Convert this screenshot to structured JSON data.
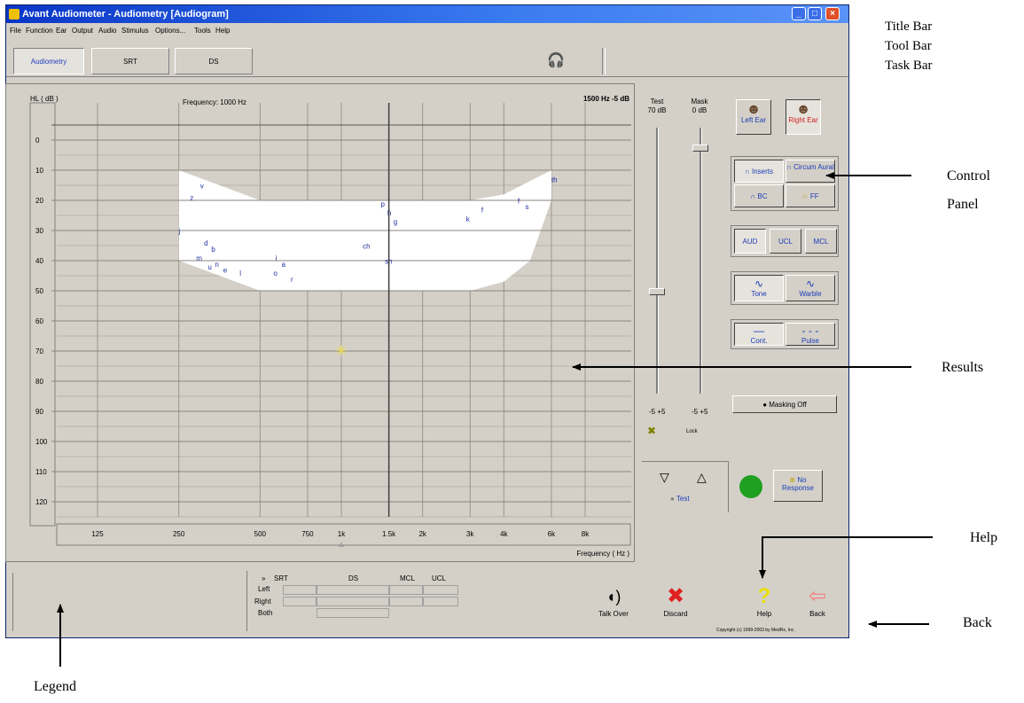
{
  "window": {
    "title": "Avant Audiometer - Audiometry [Audiogram]",
    "controls": {
      "minimize": "_",
      "maximize": "□",
      "close": "×"
    }
  },
  "menu": [
    "File",
    "Function",
    "Ear",
    "Output",
    "Audio",
    "Stimulus",
    "Options...",
    "Tools",
    "Help"
  ],
  "tabs": [
    "Audiometry",
    "SRT",
    "DS"
  ],
  "active_tab": "Audiometry",
  "audiogram": {
    "y_axis_label": "HL ( dB )",
    "frequency_readout": "Frequency: 1000 Hz",
    "status_readout": "1500 Hz -5 dB",
    "x_axis_label": "Frequency ( Hz )",
    "x_ticks": [
      {
        "label": "125",
        "hz": 125
      },
      {
        "label": "250",
        "hz": 250
      },
      {
        "label": "500",
        "hz": 500
      },
      {
        "label": "750",
        "hz": 750
      },
      {
        "label": "1k",
        "hz": 1000
      },
      {
        "label": "1.5k",
        "hz": 1500
      },
      {
        "label": "2k",
        "hz": 2000
      },
      {
        "label": "3k",
        "hz": 3000
      },
      {
        "label": "4k",
        "hz": 4000
      },
      {
        "label": "6k",
        "hz": 6000
      },
      {
        "label": "8k",
        "hz": 8000
      }
    ],
    "y_ticks": [
      0,
      10,
      20,
      30,
      40,
      50,
      60,
      70,
      80,
      90,
      100,
      110,
      120
    ],
    "x_marker_label": "△",
    "cursor_hz": 1500,
    "current_point": {
      "hz": 1000,
      "db": 70,
      "color": "#f0e040"
    },
    "speech_banana": {
      "color": "#ffffff",
      "top": [
        [
          250,
          10
        ],
        [
          500,
          20
        ],
        [
          750,
          20
        ],
        [
          1000,
          20
        ],
        [
          1500,
          20
        ],
        [
          2000,
          20
        ],
        [
          3000,
          20
        ],
        [
          4000,
          18
        ],
        [
          6000,
          10
        ]
      ],
      "bottom": [
        [
          6000,
          20
        ],
        [
          5000,
          40
        ],
        [
          4000,
          47
        ],
        [
          3000,
          50
        ],
        [
          2000,
          50
        ],
        [
          1000,
          50
        ],
        [
          750,
          50
        ],
        [
          500,
          50
        ],
        [
          250,
          40
        ]
      ]
    },
    "phonemes": [
      {
        "label": "v",
        "hz": 300,
        "db": 16
      },
      {
        "label": "z",
        "hz": 275,
        "db": 20
      },
      {
        "label": "j",
        "hz": 250,
        "db": 31
      },
      {
        "label": "d",
        "hz": 310,
        "db": 35
      },
      {
        "label": "b",
        "hz": 330,
        "db": 37
      },
      {
        "label": "m",
        "hz": 290,
        "db": 40
      },
      {
        "label": "n",
        "hz": 340,
        "db": 42
      },
      {
        "label": "u",
        "hz": 320,
        "db": 43
      },
      {
        "label": "e",
        "hz": 365,
        "db": 44
      },
      {
        "label": "l",
        "hz": 420,
        "db": 45
      },
      {
        "label": "i",
        "hz": 570,
        "db": 40
      },
      {
        "label": "a",
        "hz": 600,
        "db": 42
      },
      {
        "label": "o",
        "hz": 560,
        "db": 45
      },
      {
        "label": "r",
        "hz": 650,
        "db": 47
      },
      {
        "label": "p",
        "hz": 1400,
        "db": 22
      },
      {
        "label": "h",
        "hz": 1480,
        "db": 25
      },
      {
        "label": "g",
        "hz": 1560,
        "db": 28
      },
      {
        "label": "ch",
        "hz": 1200,
        "db": 36
      },
      {
        "label": "sh",
        "hz": 1450,
        "db": 41
      },
      {
        "label": "k",
        "hz": 2900,
        "db": 27
      },
      {
        "label": "f",
        "hz": 3300,
        "db": 24
      },
      {
        "label": "f",
        "hz": 4500,
        "db": 21
      },
      {
        "label": "s",
        "hz": 4800,
        "db": 23
      },
      {
        "label": "th",
        "hz": 6000,
        "db": 14
      }
    ]
  },
  "sliders": {
    "test": {
      "label": "Test",
      "value_label": "70 dB",
      "level_db": 70,
      "range_db": [
        -10,
        120
      ],
      "step_label": "-5  +5"
    },
    "mask": {
      "label": "Mask",
      "value_label": "0 dB",
      "level_db": 0,
      "range_db": [
        -10,
        120
      ],
      "step_label": "-5  +5"
    },
    "lock_label": "Lock"
  },
  "control_panel": {
    "ears": [
      {
        "label": "Left Ear",
        "active": false
      },
      {
        "label": "Right Ear",
        "active": true
      }
    ],
    "transducers": [
      {
        "label": "Inserts",
        "icon": "∩",
        "active": true
      },
      {
        "label": "Circum Aural",
        "icon": "∩",
        "active": false
      },
      {
        "label": "BC",
        "icon": "∩",
        "active": false
      },
      {
        "label": "FF",
        "icon": "♧",
        "active": false
      }
    ],
    "modes": [
      {
        "label": "AUD",
        "active": true
      },
      {
        "label": "UCL",
        "active": false
      },
      {
        "label": "MCL",
        "active": false
      }
    ],
    "stimulus": [
      {
        "label": "Tone",
        "icon": "∿",
        "active": true
      },
      {
        "label": "Warble",
        "icon": "∿",
        "active": false
      }
    ],
    "timing": [
      {
        "label": "Cont.",
        "icon": "—",
        "active": true
      },
      {
        "label": "Pulse",
        "icon": "- - -",
        "active": false
      }
    ],
    "masking_label": "Masking Off",
    "test_label": "Test",
    "no_response_label": "No Response",
    "response_color": "#20a020"
  },
  "score_table": {
    "arrow": "»",
    "columns": [
      "SRT",
      "DS",
      "MCL",
      "UCL"
    ],
    "rows": [
      "Left",
      "Right",
      "Both"
    ]
  },
  "bottom_buttons": [
    {
      "label": "Talk Over",
      "icon": "◖)",
      "color": "#000000"
    },
    {
      "label": "Discard",
      "icon": "✖",
      "color": "#e02020"
    },
    {
      "label": "Help",
      "icon": "?",
      "color": "#e8e000"
    },
    {
      "label": "Back",
      "icon": "⇦",
      "color": "#f08080"
    }
  ],
  "copyright": "Copyright (c) 1999-2003 by MedRx, Inc.",
  "annotations": {
    "title_bar": "Title Bar",
    "tool_bar": "Tool Bar",
    "task_bar": "Task Bar",
    "control_panel_line1": "Control",
    "control_panel_line2": "Panel",
    "results": "Results",
    "help": "Help",
    "back": "Back",
    "legend": "Legend"
  }
}
